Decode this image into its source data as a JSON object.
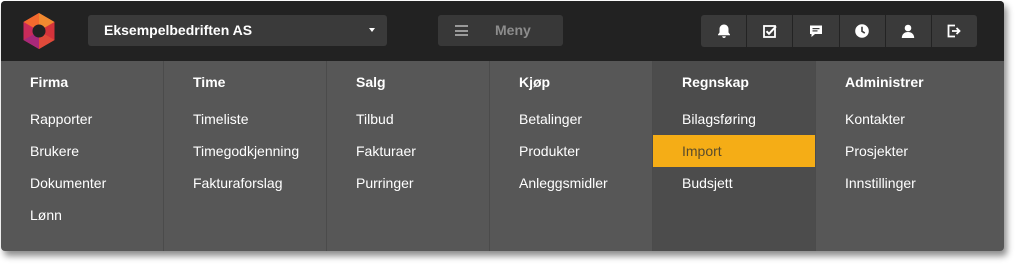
{
  "header": {
    "company": "Eksempelbedriften AS",
    "menu_label": "Meny",
    "icons": [
      "bell-icon",
      "checkbox-icon",
      "chat-icon",
      "clock-icon",
      "user-icon",
      "logout-icon"
    ]
  },
  "colors": {
    "topbar": "#222222",
    "menu_bg": "#575757",
    "highlight": "#f5ad16"
  },
  "menu": {
    "columns": [
      {
        "heading": "Firma",
        "items": [
          "Rapporter",
          "Brukere",
          "Dokumenter",
          "Lønn"
        ]
      },
      {
        "heading": "Time",
        "items": [
          "Timeliste",
          "Timegodkjenning",
          "Fakturaforslag"
        ]
      },
      {
        "heading": "Salg",
        "items": [
          "Tilbud",
          "Fakturaer",
          "Purringer"
        ]
      },
      {
        "heading": "Kjøp",
        "items": [
          "Betalinger",
          "Produkter",
          "Anleggsmidler"
        ]
      },
      {
        "heading": "Regnskap",
        "items": [
          "Bilagsføring",
          "Import",
          "Budsjett"
        ]
      },
      {
        "heading": "Administrer",
        "items": [
          "Kontakter",
          "Prosjekter",
          "Innstillinger"
        ]
      }
    ]
  }
}
